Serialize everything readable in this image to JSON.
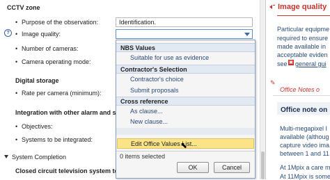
{
  "form": {
    "cctv_zone": "CCTV zone",
    "purpose_label": "Purpose of the observation:",
    "purpose_value": "Identification.",
    "image_quality_label": "Image quality:",
    "image_quality_value": "",
    "cameras_label": "Number of cameras:",
    "operating_mode_label": "Camera operating mode:",
    "digital_storage": "Digital storage",
    "rate_label": "Rate per camera (minimum):",
    "integration": "Integration with other alarm and sec",
    "objectives_label": "Objectives:",
    "systems_label": "Systems to be integrated:",
    "system_completion": "System Completion",
    "closed_circuit": "Closed circuit television system testi"
  },
  "dropdown": {
    "nbs_values": "NBS Values",
    "suitable_evidence": "Suitable for use as evidence",
    "contractors_selection": "Contractor's Selection",
    "contractors_choice": "Contractor's choice",
    "submit_proposals": "Submit proposals",
    "cross_reference": "Cross reference",
    "as_clause": "As clause...",
    "new_clause": "New clause...",
    "edit_office_values": "Edit Office Values List...",
    "items_selected": "0 items selected",
    "ok": "OK",
    "cancel": "Cancel"
  },
  "right_pane": {
    "image_quality_title": "Image quality",
    "guidance_lines": [
      "Particular equipme",
      "required to ensure",
      "made available in",
      "acceptable eviden",
      "see"
    ],
    "general_guidance_link": "general gui",
    "office_notes_header": "Office Notes o",
    "office_note_on": "Office note on",
    "note_lines": [
      "Multi-megapixel I",
      "available (althoug",
      "capture video ima",
      "between 1 and 11"
    ],
    "note_lines_2": [
      "At 1Mpix a care m",
      "At 11Mpix is some"
    ]
  },
  "colors": {
    "accent_red": "#c8352c",
    "link_blue": "#2a4d7a",
    "highlight_yellow": "#fbe487",
    "group_header": "#e3e9f2"
  },
  "icons": {
    "help": "help-circle-icon",
    "collapse": "triangle-collapse-icon",
    "section_image": "image-icon",
    "notes": "pencil-notes-icon"
  }
}
